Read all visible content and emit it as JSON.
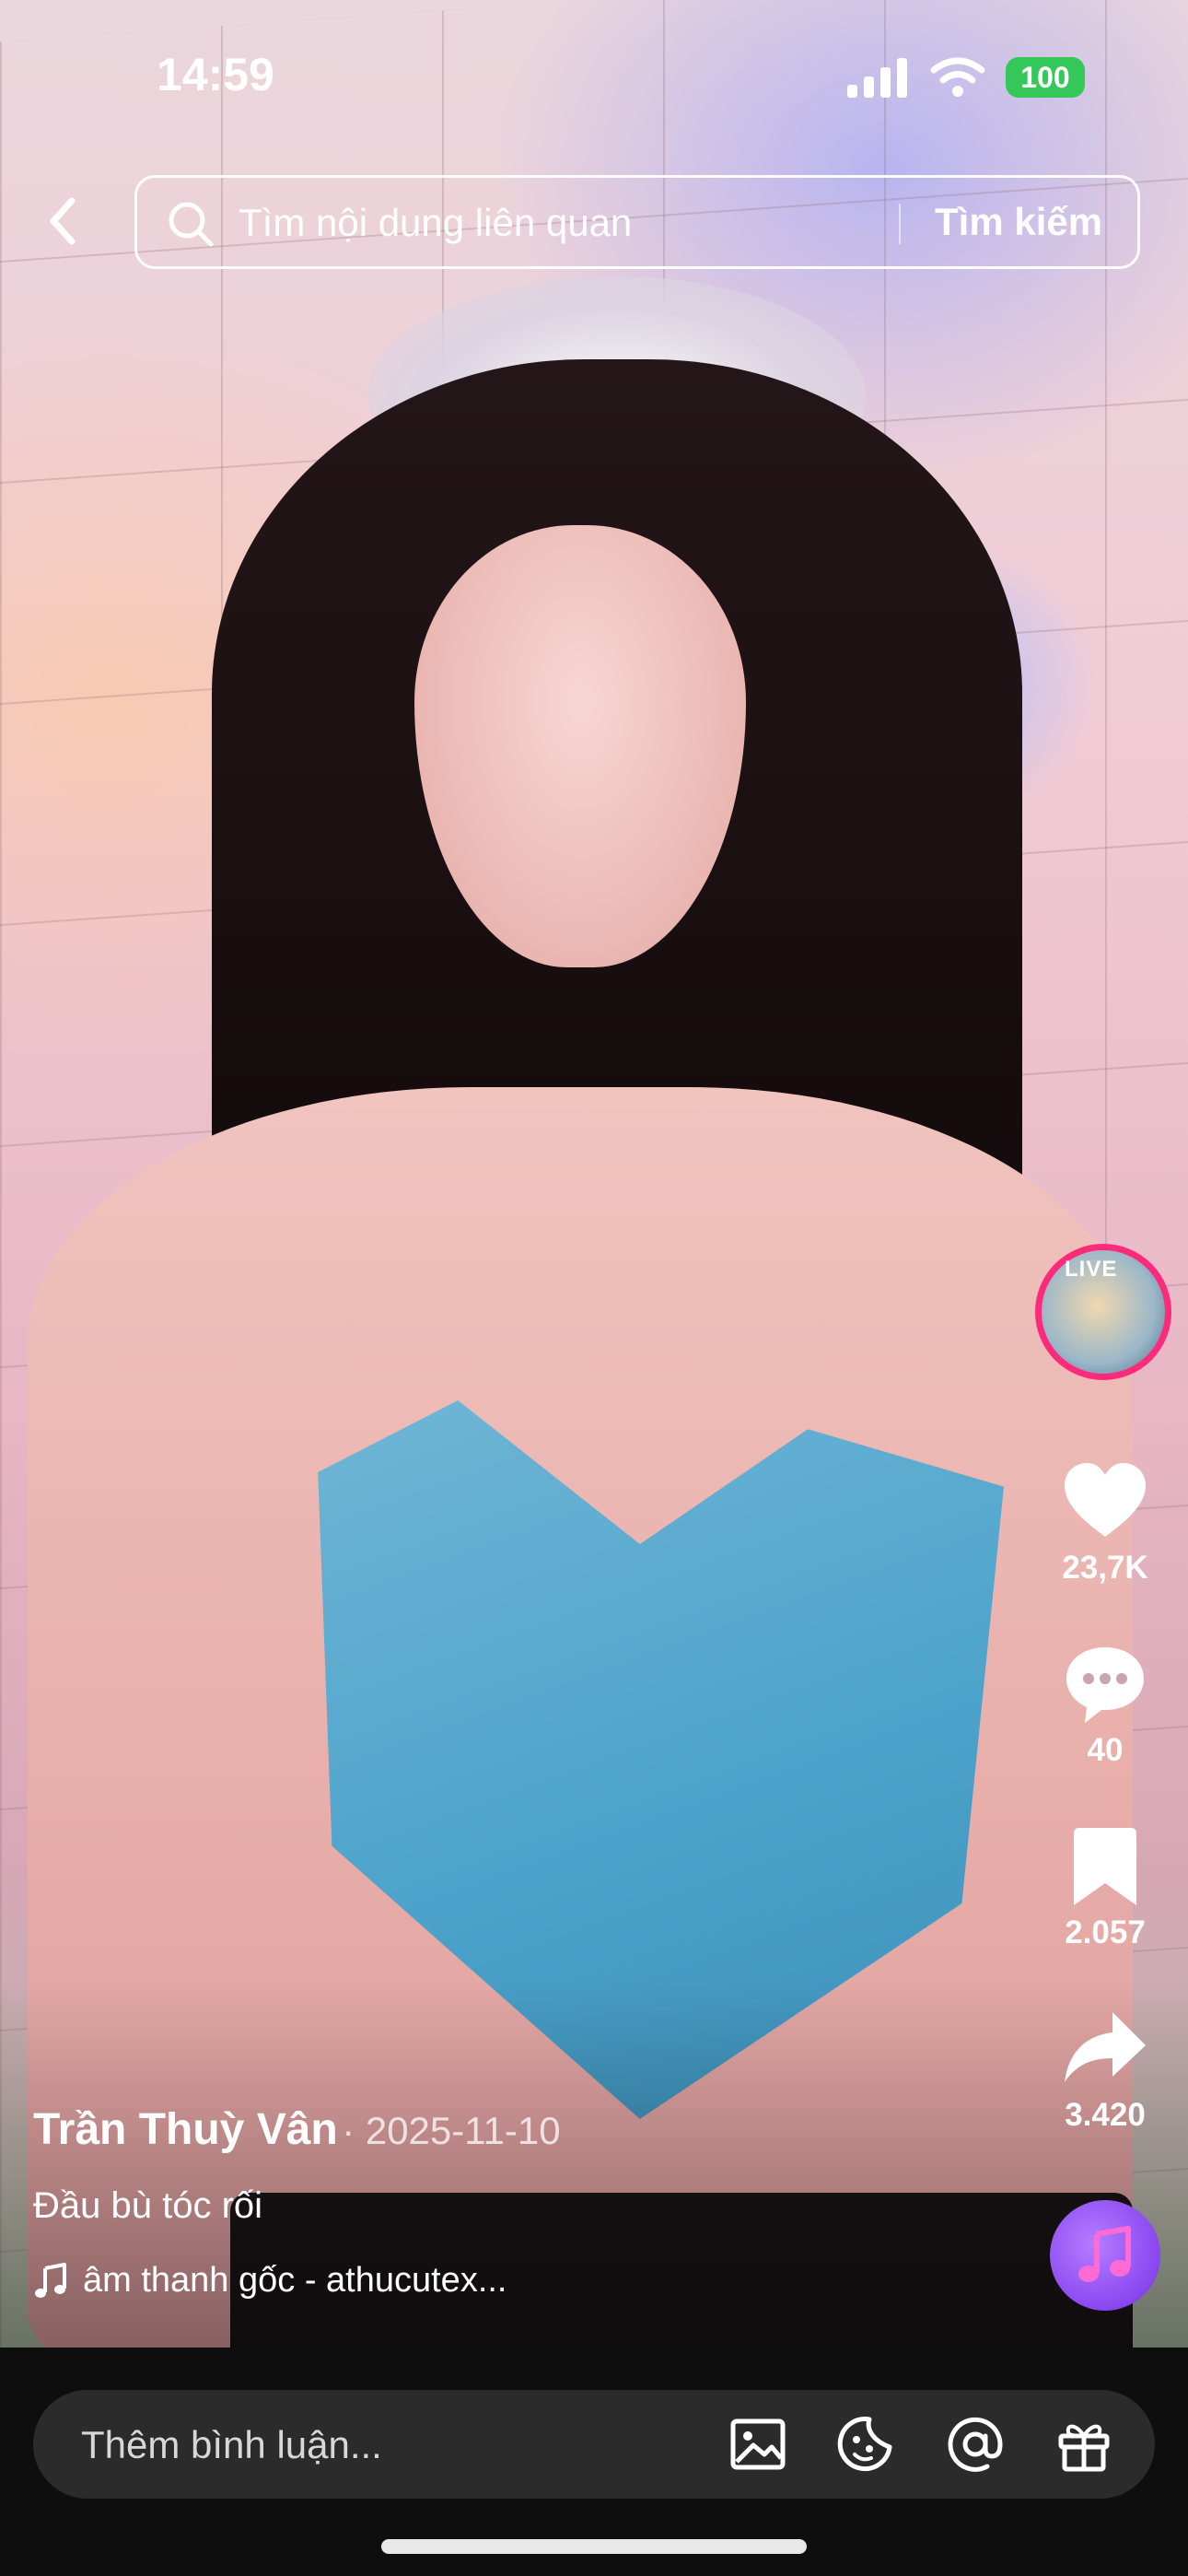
{
  "status_bar": {
    "time": "14:59",
    "battery": "100"
  },
  "search": {
    "placeholder": "Tìm nội dung liên quan",
    "button_label": "Tìm kiếm"
  },
  "live_avatar": {
    "badge": "LIVE"
  },
  "actions": {
    "likes": "23,7K",
    "comments": "40",
    "saves": "2.057",
    "shares": "3.420"
  },
  "post": {
    "author": "Trần Thuỳ Vân",
    "date": "· 2025-11-10",
    "caption": "Đầu bù tóc rối",
    "sound": "âm thanh gốc - athucutex..."
  },
  "comment_bar": {
    "placeholder": "Thêm bình luận..."
  },
  "colors": {
    "accent_live": "#ff2a7a",
    "battery": "#34c759",
    "music_disc": "#8a47f0"
  },
  "icons": [
    "back-icon",
    "search-icon",
    "heart-icon",
    "comment-icon",
    "bookmark-icon",
    "share-icon",
    "music-note-icon",
    "image-icon",
    "sticker-icon",
    "mention-icon",
    "gift-icon"
  ]
}
